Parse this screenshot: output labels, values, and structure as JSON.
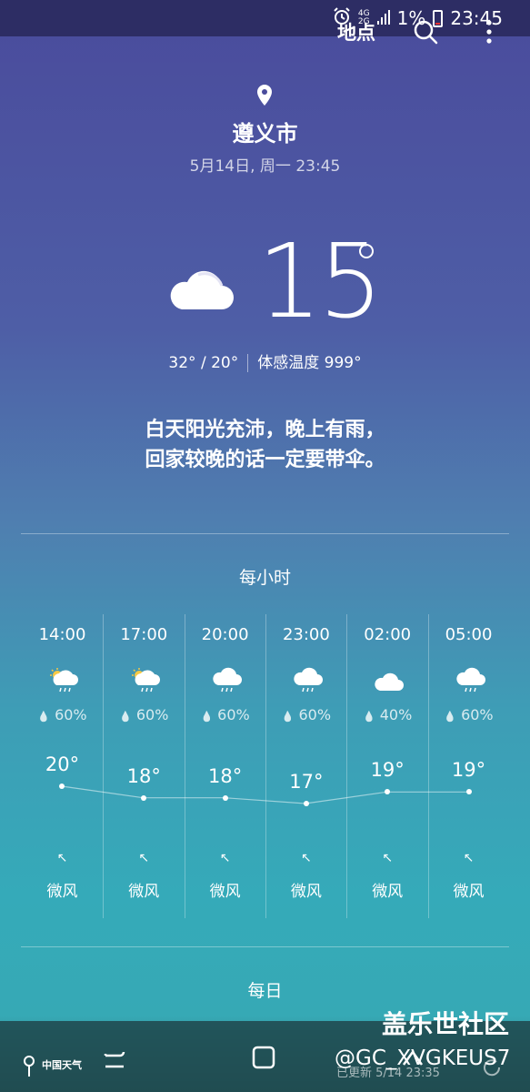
{
  "status_bar": {
    "network_top": "4G",
    "network_bottom": "2G",
    "battery": "1%",
    "time": "23:45"
  },
  "toolbar": {
    "locations_label": "地点",
    "search_icon": "search-icon",
    "more_icon": "more-vert-icon"
  },
  "current": {
    "city": "遵义市",
    "datetime": "5月14日, 周一 23:45",
    "temperature": "15",
    "condition_icon": "cloudy-icon",
    "hi_lo": "32° / 20°",
    "feels_like": "体感温度 999°",
    "message_line1": "白天阳光充沛，晚上有雨，",
    "message_line2": "回家较晚的话一定要带伞。"
  },
  "hourly": {
    "title": "每小时",
    "items": [
      {
        "time": "14:00",
        "icon": "partly-sunny-rain-icon",
        "precip": "60%",
        "temp": "20°",
        "temp_value": 20,
        "wind": "微风",
        "wind_arrow": "↖"
      },
      {
        "time": "17:00",
        "icon": "partly-sunny-rain-icon",
        "precip": "60%",
        "temp": "18°",
        "temp_value": 18,
        "wind": "微风",
        "wind_arrow": "↖"
      },
      {
        "time": "20:00",
        "icon": "rain-icon",
        "precip": "60%",
        "temp": "18°",
        "temp_value": 18,
        "wind": "微风",
        "wind_arrow": "↖"
      },
      {
        "time": "23:00",
        "icon": "rain-icon",
        "precip": "60%",
        "temp": "17°",
        "temp_value": 17,
        "wind": "微风",
        "wind_arrow": "↖"
      },
      {
        "time": "02:00",
        "icon": "cloudy-icon",
        "precip": "40%",
        "temp": "19°",
        "temp_value": 19,
        "wind": "微风",
        "wind_arrow": "↖"
      },
      {
        "time": "05:00",
        "icon": "rain-icon",
        "precip": "60%",
        "temp": "19°",
        "temp_value": 19,
        "wind": "微风",
        "wind_arrow": "↖"
      }
    ]
  },
  "daily": {
    "title": "每日",
    "updated": "已更新 5/14 23:35"
  },
  "watermarks": {
    "forum": "盖乐世社区",
    "user": "@GC_XVGKEUS7",
    "provider": "中国天气"
  }
}
